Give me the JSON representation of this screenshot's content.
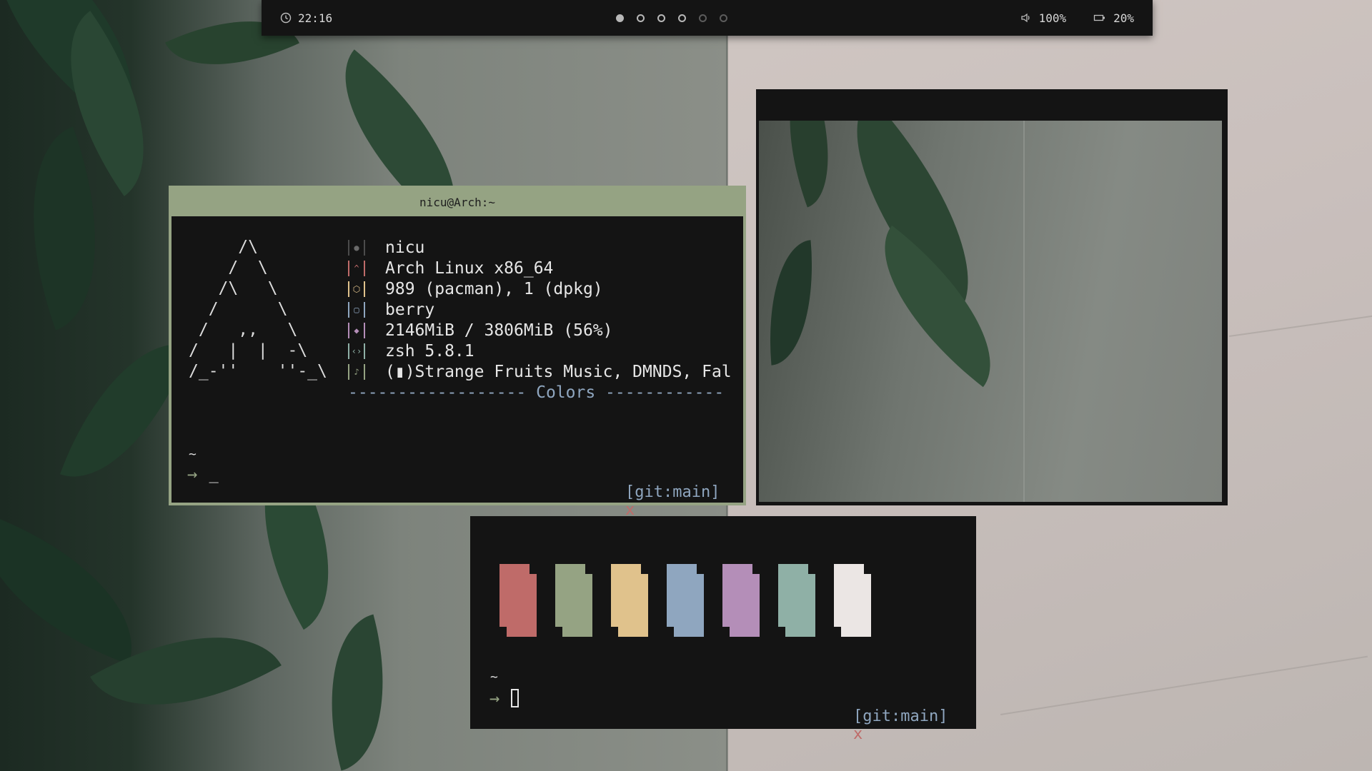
{
  "topbar": {
    "clock_icon": "clock-icon",
    "time": "22:16",
    "workspaces": [
      {
        "state": "active"
      },
      {
        "state": "occupied"
      },
      {
        "state": "occupied"
      },
      {
        "state": "occupied"
      },
      {
        "state": "empty"
      },
      {
        "state": "empty"
      }
    ],
    "volume_icon": "speaker-icon",
    "volume": "100%",
    "battery_icon": "battery-icon",
    "battery": "20%"
  },
  "terminal1": {
    "title": "nicu@Arch:~",
    "ascii_logo": "     /\\\n    /  \\\n   /\\   \\\n  /      \\\n /   ,,   \\\n/   |  |  -\\\n/_-''    ''-_\\",
    "info": [
      {
        "icon": "user-icon",
        "color": "grey",
        "glyph": "●",
        "value": "nicu"
      },
      {
        "icon": "arch-icon",
        "color": "red",
        "glyph": "^",
        "value": "Arch Linux x86_64"
      },
      {
        "icon": "package-icon",
        "color": "yellow",
        "glyph": "⬡",
        "value": "989 (pacman), 1 (dpkg)"
      },
      {
        "icon": "window-icon",
        "color": "blue",
        "glyph": "▢",
        "value": "berry"
      },
      {
        "icon": "memory-icon",
        "color": "magenta",
        "glyph": "◆",
        "value": "2146MiB / 3806MiB (56%)"
      },
      {
        "icon": "shell-icon",
        "color": "cyan",
        "glyph": "‹›",
        "value": "zsh 5.8.1"
      },
      {
        "icon": "music-icon",
        "color": "green",
        "glyph": "♪",
        "value": "(▮)Strange Fruits Music, DMNDS, Fal"
      }
    ],
    "colors_line": "------------------ Colors ------------",
    "prompt_tilde": "~",
    "prompt_arrow": "→",
    "prompt_cursor": "_",
    "git_tag": "[git:main]",
    "git_dirty": "x"
  },
  "terminal2": {
    "palette": [
      "#bf6b69",
      "#95a383",
      "#e0c28c",
      "#8fa6bf",
      "#b48eb8",
      "#8fb0a6",
      "#ebe6e4"
    ],
    "prompt_tilde": "~",
    "prompt_arrow": "→",
    "git_tag": "[git:main]",
    "git_dirty": "x"
  },
  "colors": {
    "bar_bg": "#141414",
    "accent": "#95a383",
    "red": "#bf6b69",
    "blue": "#8fa6bf"
  }
}
